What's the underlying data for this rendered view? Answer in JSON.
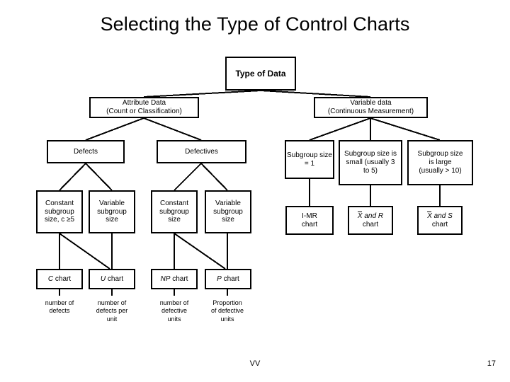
{
  "slide": {
    "title": "Selecting the Type of Control Charts",
    "footer_center": "VV",
    "page_number": "17"
  },
  "diagram": {
    "type": "flowchart",
    "root": {
      "label": "Type of Data"
    },
    "level2": [
      {
        "line1": "Attribute Data",
        "line2": "(Count or Classification)"
      },
      {
        "line1": "Variable data",
        "line2": "(Continuous Measurement)"
      }
    ],
    "attribute_branch": {
      "categories": [
        {
          "label": "Defects"
        },
        {
          "label": "Defectives"
        }
      ],
      "subgroups": [
        {
          "line1": "Constant",
          "line2": "subgroup",
          "line3": "size, c ≥5"
        },
        {
          "line1": "Variable",
          "line2": "subgroup",
          "line3": "size"
        },
        {
          "line1": "Constant",
          "line2": "subgroup",
          "line3": "size"
        },
        {
          "line1": "Variable",
          "line2": "subgroup",
          "line3": "size"
        }
      ],
      "charts": [
        {
          "symbol": "C",
          "suffix": " chart"
        },
        {
          "symbol": "U",
          "suffix": " chart"
        },
        {
          "symbol": "NP",
          "suffix": " chart"
        },
        {
          "symbol": "P",
          "suffix": " chart"
        }
      ],
      "captions": [
        {
          "line1": "number of",
          "line2": "defects",
          "line3": ""
        },
        {
          "line1": "number of",
          "line2": "defects per",
          "line3": "unit"
        },
        {
          "line1": "number of",
          "line2": "defective",
          "line3": "units"
        },
        {
          "line1": "Proportion",
          "line2": "of defective",
          "line3": "units"
        }
      ]
    },
    "variable_branch": {
      "subgroups": [
        {
          "line1": "Subgroup size",
          "line2": "= 1",
          "line3": ""
        },
        {
          "line1": "Subgroup size is",
          "line2": "small (usually 3",
          "line3": "to 5)"
        },
        {
          "line1": "Subgroup size",
          "line2": "is large",
          "line3": "(usually > 10)"
        }
      ],
      "charts": [
        {
          "prefix": "",
          "bar": "",
          "mid": "I-MR",
          "suffix": "chart"
        },
        {
          "prefix": "",
          "bar": "X",
          "mid": " and R",
          "suffix": "chart"
        },
        {
          "prefix": "",
          "bar": "X",
          "mid": " and S",
          "suffix": "chart"
        }
      ]
    }
  }
}
